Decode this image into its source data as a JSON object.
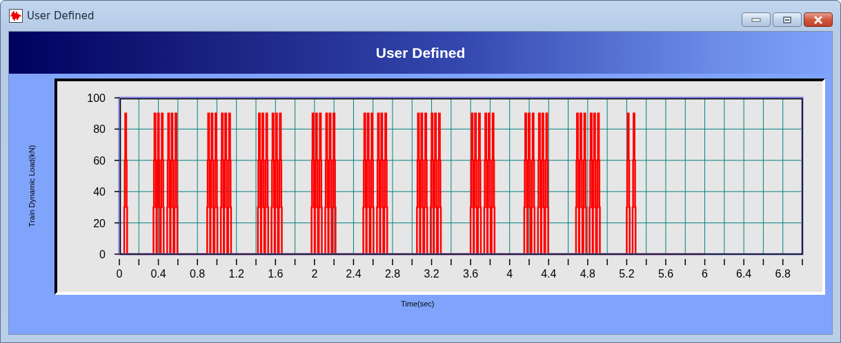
{
  "window": {
    "title": "User Defined"
  },
  "header": {
    "title": "User Defined"
  },
  "chart": {
    "ylabel": "Train Dynamic Load(kN)",
    "xlabel": "Time(sec)",
    "yticks": [
      "100",
      "80",
      "60",
      "40",
      "20",
      "0"
    ],
    "xticks": [
      "0",
      "0.4",
      "0.8",
      "1.2",
      "1.6",
      "2",
      "2.4",
      "2.8",
      "3.2",
      "3.6",
      "4",
      "4.4",
      "4.8",
      "5.2",
      "5.6",
      "6",
      "6.4",
      "6.8"
    ]
  }
}
